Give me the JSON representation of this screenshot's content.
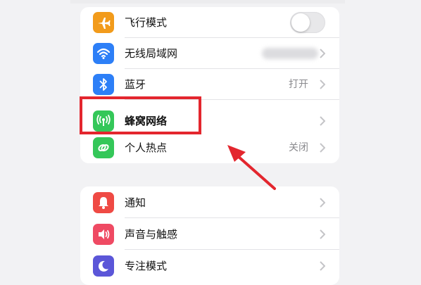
{
  "colors": {
    "airplane_icon_bg": "#f29b1b",
    "wifi_icon_bg": "#2d7ff7",
    "bluetooth_icon_bg": "#2d7ff7",
    "cellular_icon_bg": "#34c759",
    "hotspot_icon_bg": "#34c759",
    "notifications_icon_bg": "#ef4a44",
    "sounds_icon_bg": "#ef4a63",
    "focus_icon_bg": "#5b56d8",
    "highlight_border": "#e3262e",
    "annotation_arrow": "#e3262e"
  },
  "settings": {
    "group1": {
      "airplane_mode": {
        "label": "飞行模式",
        "icon": "airplane-icon",
        "toggle": "off"
      },
      "wifi": {
        "label": "无线局域网",
        "icon": "wifi-icon",
        "value": ""
      },
      "bluetooth": {
        "label": "蓝牙",
        "icon": "bluetooth-icon",
        "value": "打开"
      },
      "cellular": {
        "label": "蜂窝网络",
        "icon": "cellular-antenna-icon"
      },
      "hotspot": {
        "label": "个人热点",
        "icon": "hotspot-link-icon",
        "value": "关闭"
      }
    },
    "group2": {
      "notifications": {
        "label": "通知",
        "icon": "notification-bell-icon"
      },
      "sounds": {
        "label": "声音与触感",
        "icon": "speaker-icon"
      },
      "focus": {
        "label": "专注模式",
        "icon": "moon-icon"
      }
    }
  },
  "annotation": {
    "highlighted_item": "蜂窝网络"
  }
}
